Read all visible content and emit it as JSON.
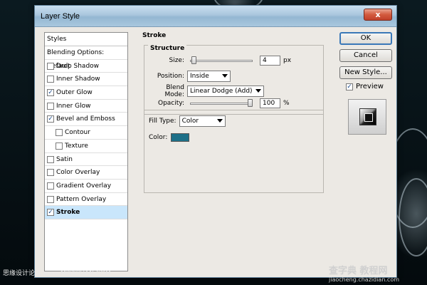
{
  "window": {
    "title": "Layer Style",
    "close_label": "x"
  },
  "styles_list": {
    "header": "Styles",
    "items": [
      {
        "label": "Blending Options: Default",
        "checkbox": false,
        "checked": false
      },
      {
        "label": "Drop Shadow",
        "checkbox": true,
        "checked": false
      },
      {
        "label": "Inner Shadow",
        "checkbox": true,
        "checked": false
      },
      {
        "label": "Outer Glow",
        "checkbox": true,
        "checked": true
      },
      {
        "label": "Inner Glow",
        "checkbox": true,
        "checked": false
      },
      {
        "label": "Bevel and Emboss",
        "checkbox": true,
        "checked": true
      },
      {
        "label": "Contour",
        "checkbox": true,
        "checked": false,
        "sub": true
      },
      {
        "label": "Texture",
        "checkbox": true,
        "checked": false,
        "sub": true
      },
      {
        "label": "Satin",
        "checkbox": true,
        "checked": false
      },
      {
        "label": "Color Overlay",
        "checkbox": true,
        "checked": false
      },
      {
        "label": "Gradient Overlay",
        "checkbox": true,
        "checked": false
      },
      {
        "label": "Pattern Overlay",
        "checkbox": true,
        "checked": false
      },
      {
        "label": "Stroke",
        "checkbox": true,
        "checked": true,
        "selected": true
      }
    ]
  },
  "stroke": {
    "title": "Stroke",
    "structure_label": "Structure",
    "size_label": "Size:",
    "size_value": "4",
    "size_unit": "px",
    "size_slider_fraction": 0.02,
    "position_label": "Position:",
    "position_value": "Inside",
    "blend_label": "Blend Mode:",
    "blend_value": "Linear Dodge (Add)",
    "opacity_label": "Opacity:",
    "opacity_value": "100",
    "opacity_unit": "%",
    "opacity_slider_fraction": 1.0,
    "fill_type_label": "Fill Type:",
    "fill_type_value": "Color",
    "color_label": "Color:",
    "color_value": "#1e7088"
  },
  "buttons": {
    "ok": "OK",
    "cancel": "Cancel",
    "new_style": "New Style...",
    "preview": "Preview",
    "preview_checked": true
  },
  "watermarks": {
    "left": "思缘设计论坛 www.MISSYUAN.COM",
    "right_main": "查字典 教程网",
    "right_url": "jiaocheng.chazidian.com"
  }
}
